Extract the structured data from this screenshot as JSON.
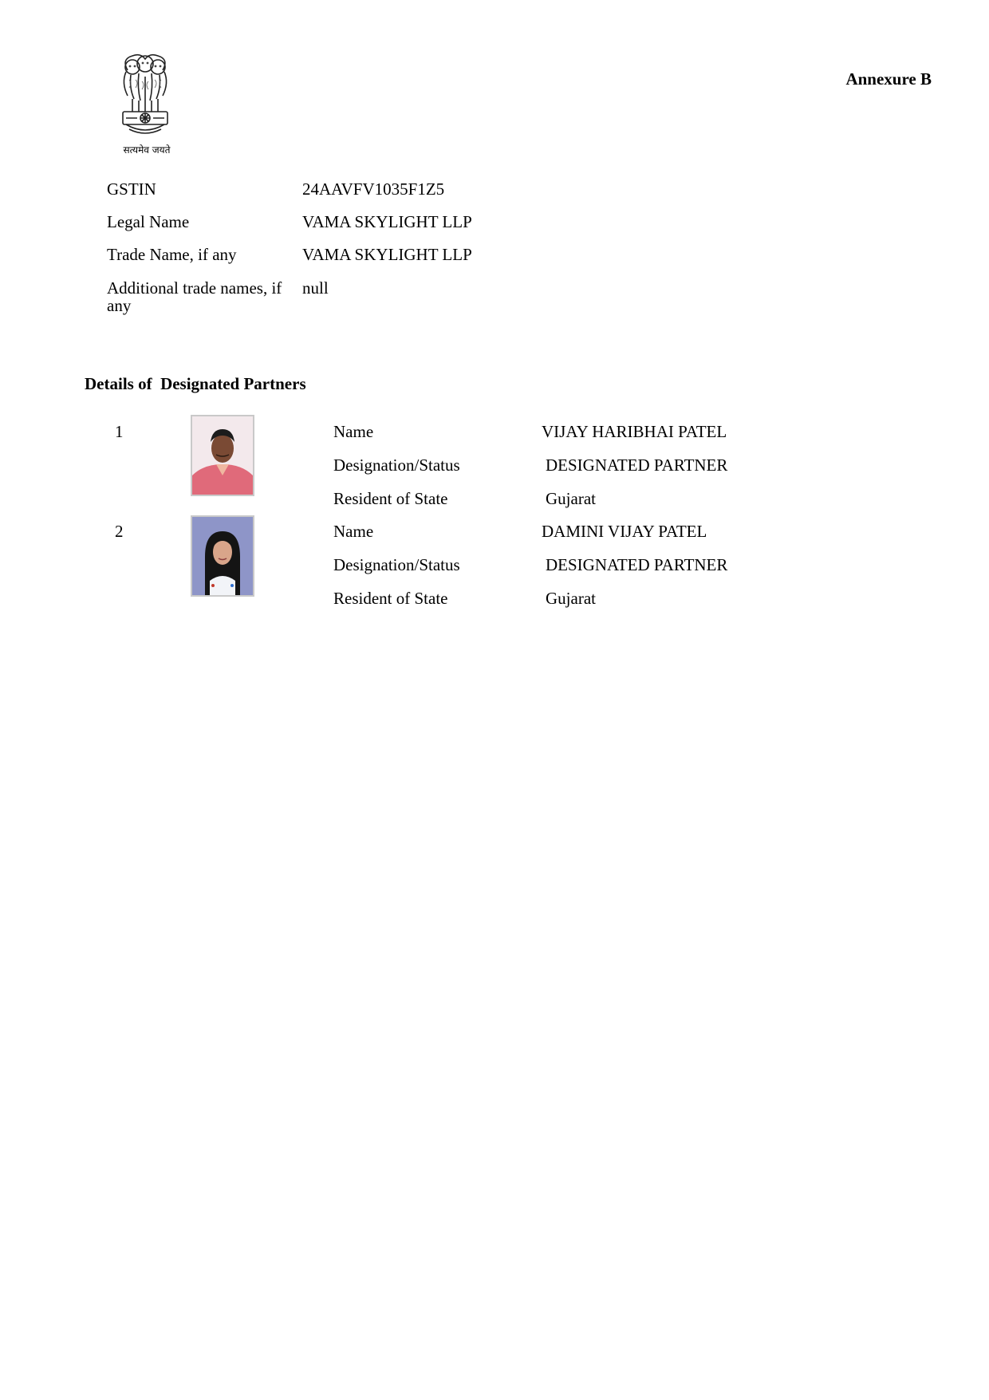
{
  "header": {
    "emblem_motto": "सत्यमेव जयते",
    "annexure": "Annexure B"
  },
  "info": [
    {
      "label": "GSTIN",
      "value": "24AAVFV1035F1Z5"
    },
    {
      "label": "Legal Name",
      "value": "VAMA SKYLIGHT LLP"
    },
    {
      "label": "Trade Name, if any",
      "value": "VAMA SKYLIGHT LLP"
    },
    {
      "label": "Additional trade names, if any",
      "value": "null"
    }
  ],
  "partners_section": {
    "title": "Details of  Designated Partners",
    "labels": {
      "name": "Name",
      "designation": "Designation/Status",
      "state": "Resident of State"
    },
    "partners": [
      {
        "sno": "1",
        "name": "VIJAY HARIBHAI PATEL",
        "designation": "DESIGNATED PARTNER",
        "state": "Gujarat"
      },
      {
        "sno": "2",
        "name": "DAMINI VIJAY PATEL",
        "designation": "DESIGNATED PARTNER",
        "state": "Gujarat"
      }
    ]
  },
  "colors": {
    "photo1_background": "#e7a8b2",
    "photo1_shirt": "#e06a7a",
    "photo2_background": "#8e95c8",
    "photo2_top": "#f2f4f8"
  }
}
